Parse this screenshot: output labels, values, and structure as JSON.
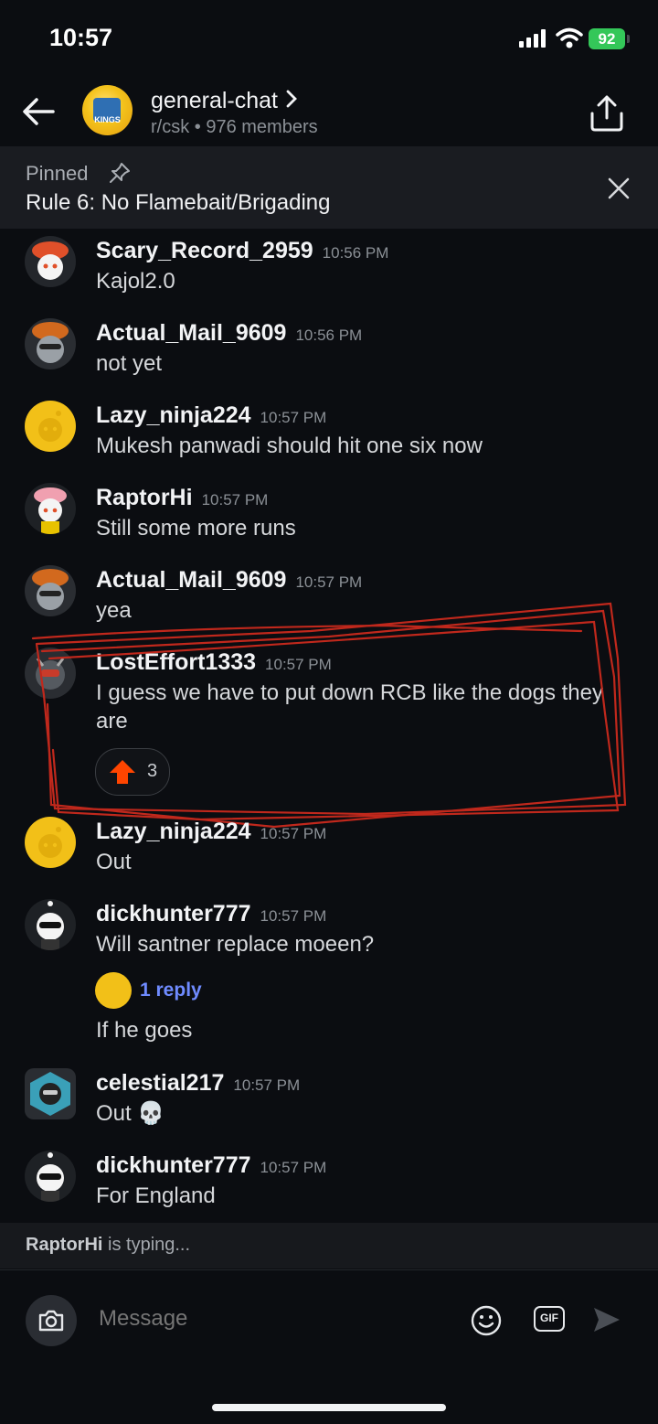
{
  "status_bar": {
    "time": "10:57",
    "battery": "92"
  },
  "header": {
    "title": "general-chat",
    "subtitle": "r/csk • 976 members",
    "icons": [
      "back-arrow-icon",
      "chevron-right-icon",
      "share-icon"
    ]
  },
  "pinned": {
    "label": "Pinned",
    "text": "Rule 6: No Flamebait/Brigading"
  },
  "messages": [
    {
      "user": "Scary_Record_2959",
      "time": "10:56 PM",
      "text": "Kajol2.0"
    },
    {
      "user": "Actual_Mail_9609",
      "time": "10:56 PM",
      "text": "not yet"
    },
    {
      "user": "Lazy_ninja224",
      "time": "10:57 PM",
      "text": "Mukesh panwadi should hit one six now"
    },
    {
      "user": "RaptorHi",
      "time": "10:57 PM",
      "text": "Still some more runs"
    },
    {
      "user": "Actual_Mail_9609",
      "time": "10:57 PM",
      "text": "yea"
    },
    {
      "user": "LostEffort1333",
      "time": "10:57 PM",
      "text": "I guess we have to put down RCB like the dogs they are",
      "upvotes": "3"
    },
    {
      "user": "Lazy_ninja224",
      "time": "10:57 PM",
      "text": "Out"
    },
    {
      "user": "dickhunter777",
      "time": "10:57 PM",
      "text": "Will santner replace moeen?",
      "reply_count": "1 reply"
    },
    {
      "user": "",
      "time": "",
      "text": "If he goes"
    },
    {
      "user": "celestial217",
      "time": "10:57 PM",
      "text": "Out 💀"
    },
    {
      "user": "dickhunter777",
      "time": "10:57 PM",
      "text": "For England"
    }
  ],
  "typing": {
    "user": "RaptorHi",
    "suffix": " is typing..."
  },
  "composer": {
    "placeholder": "Message",
    "gif_label": "GIF"
  },
  "colors": {
    "background": "#0b0d11",
    "upvote": "#ff4500",
    "reply_link": "#6f8bff",
    "annotation": "#c0281c",
    "battery": "#34c759"
  }
}
